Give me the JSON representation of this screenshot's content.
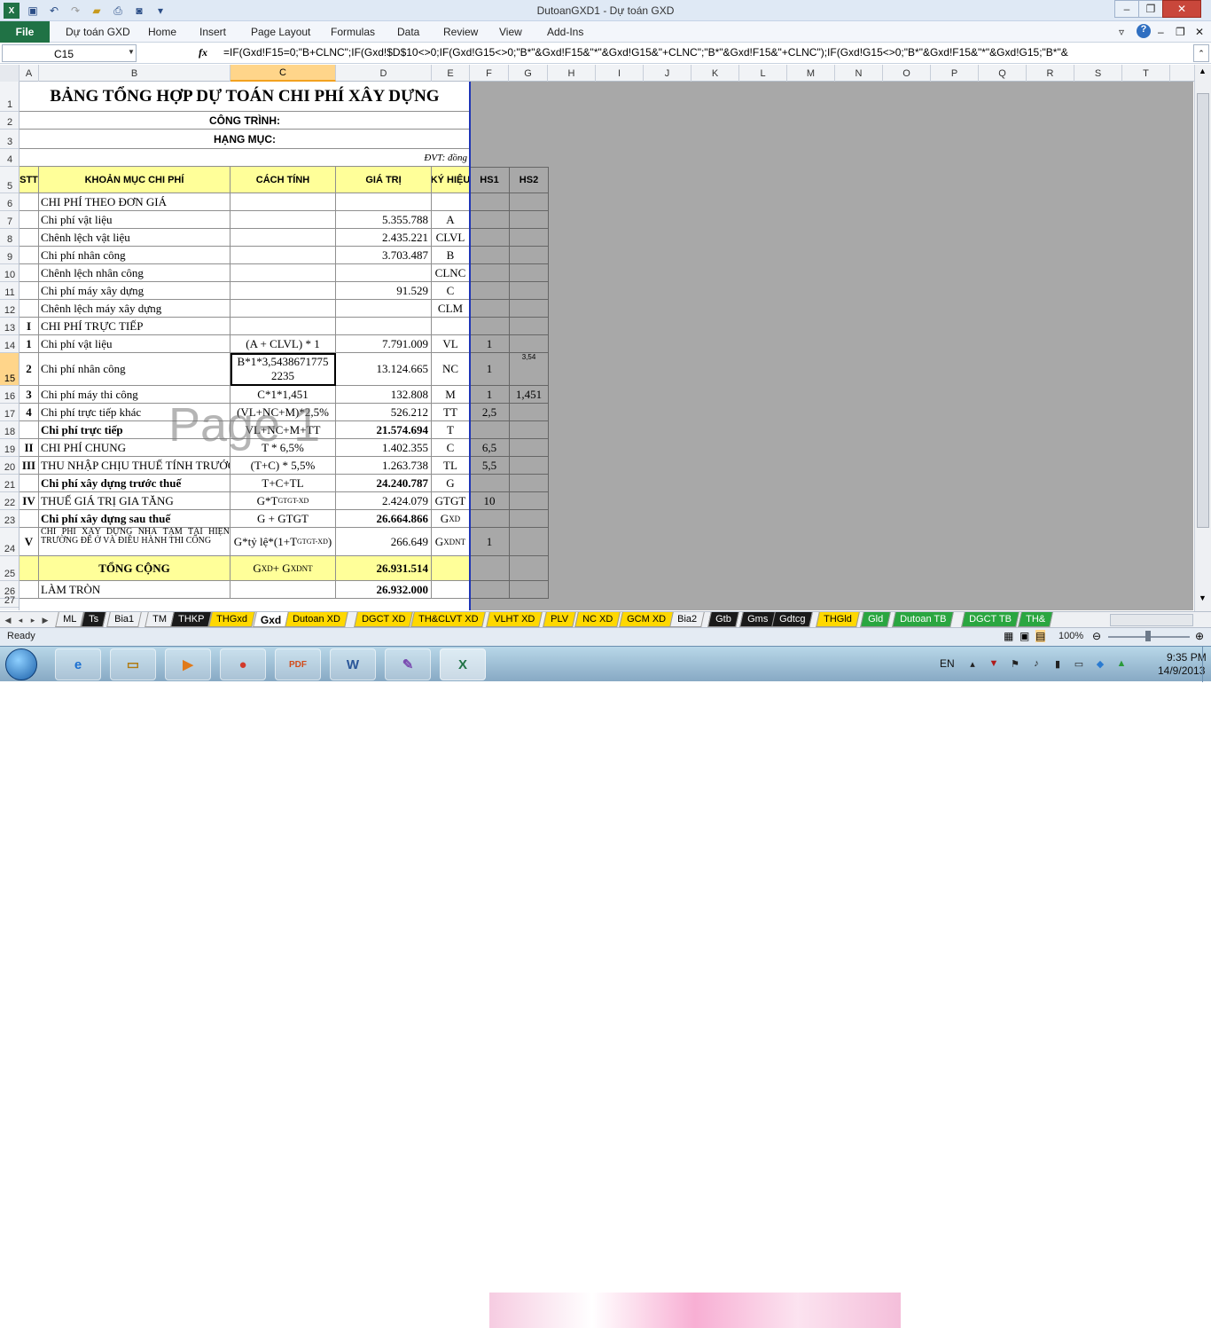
{
  "window": {
    "title": "DutoanGXD1 - Dự toán GXD"
  },
  "ribbon": {
    "file": "File",
    "tabs": [
      "Dự toán GXD",
      "Home",
      "Insert",
      "Page Layout",
      "Formulas",
      "Data",
      "Review",
      "View",
      "Add-Ins"
    ]
  },
  "formula_bar": {
    "name_box": "C15",
    "fx": "fx",
    "formula": "=IF(Gxd!F15=0;\"B+CLNC\";IF(Gxd!$D$10<>0;IF(Gxd!G15<>0;\"B*\"&Gxd!F15&\"*\"&Gxd!G15&\"+CLNC\";\"B*\"&Gxd!F15&\"+CLNC\");IF(Gxd!G15<>0;\"B*\"&Gxd!F15&\"*\"&Gxd!G15;\"B*\"&"
  },
  "columns": [
    "A",
    "B",
    "C",
    "D",
    "E",
    "F",
    "G",
    "H",
    "I",
    "J",
    "K",
    "L",
    "M",
    "N",
    "O",
    "P",
    "Q",
    "R",
    "S",
    "T"
  ],
  "rows_numbers": [
    "1",
    "2",
    "3",
    "4",
    "5",
    "6",
    "7",
    "8",
    "9",
    "10",
    "11",
    "12",
    "13",
    "14",
    "15",
    "16",
    "17",
    "18",
    "19",
    "20",
    "21",
    "22",
    "23",
    "24",
    "25",
    "26",
    "27"
  ],
  "sheet": {
    "title": "BẢNG TỔNG HỢP DỰ TOÁN CHI PHÍ XÂY DỰNG",
    "project": "CÔNG TRÌNH:",
    "item": "HẠNG MỤC:",
    "unit": "ĐVT: đồng",
    "headers": {
      "stt": "STT",
      "khoan_muc": "KHOẢN MỤC CHI PHÍ",
      "cach_tinh": "CÁCH TÍNH",
      "gia_tri": "GIÁ TRỊ",
      "ky_hieu": "KÝ HIỆU",
      "hs1": "HS1",
      "hs2": "HS2"
    },
    "rows": [
      {
        "stt": "",
        "name": "CHI PHÍ THEO ĐƠN GIÁ",
        "calc": "",
        "value": "",
        "sym": "",
        "hs1": "",
        "hs2": ""
      },
      {
        "stt": "",
        "name": "Chi phí vật liệu",
        "calc": "",
        "value": "5.355.788",
        "sym": "A",
        "hs1": "",
        "hs2": ""
      },
      {
        "stt": "",
        "name": "Chênh lệch vật liệu",
        "calc": "",
        "value": "2.435.221",
        "sym": "CLVL",
        "hs1": "",
        "hs2": ""
      },
      {
        "stt": "",
        "name": "Chi phí nhân công",
        "calc": "",
        "value": "3.703.487",
        "sym": "B",
        "hs1": "",
        "hs2": ""
      },
      {
        "stt": "",
        "name": "Chênh lệch nhân công",
        "calc": "",
        "value": "",
        "sym": "CLNC",
        "hs1": "",
        "hs2": ""
      },
      {
        "stt": "",
        "name": "Chi phí máy xây dựng",
        "calc": "",
        "value": "91.529",
        "sym": "C",
        "hs1": "",
        "hs2": ""
      },
      {
        "stt": "",
        "name": "Chênh lệch máy xây dựng",
        "calc": "",
        "value": "",
        "sym": "CLM",
        "hs1": "",
        "hs2": ""
      },
      {
        "stt": "I",
        "name": "CHI PHÍ TRỰC TIẾP",
        "calc": "",
        "value": "",
        "sym": "",
        "hs1": "",
        "hs2": ""
      },
      {
        "stt": "1",
        "name": "Chi phí vật liệu",
        "calc": "(A + CLVL) * 1",
        "value": "7.791.009",
        "sym": "VL",
        "hs1": "1",
        "hs2": ""
      },
      {
        "stt": "2",
        "name": "Chi phí nhân công",
        "calc": "B*1*3,5438671775 2235",
        "value": "13.124.665",
        "sym": "NC",
        "hs1": "1",
        "hs2": "3,54"
      },
      {
        "stt": "3",
        "name": "Chi phí máy thi công",
        "calc": "C*1*1,451",
        "value": "132.808",
        "sym": "M",
        "hs1": "1",
        "hs2": "1,451"
      },
      {
        "stt": "4",
        "name": "Chi phí trực tiếp khác",
        "calc": "(VL+NC+M)*2,5%",
        "value": "526.212",
        "sym": "TT",
        "hs1": "2,5",
        "hs2": ""
      },
      {
        "stt": "",
        "name": "Chi phí trực tiếp",
        "calc": "VL+NC+M+TT",
        "value": "21.574.694",
        "sym": "T",
        "hs1": "",
        "hs2": ""
      },
      {
        "stt": "II",
        "name": "CHI PHÍ CHUNG",
        "calc": "T * 6,5%",
        "value": "1.402.355",
        "sym": "C",
        "hs1": "6,5",
        "hs2": ""
      },
      {
        "stt": "III",
        "name": "THU NHẬP CHỊU THUẾ TÍNH TRƯỚC",
        "calc": "(T+C) * 5,5%",
        "value": "1.263.738",
        "sym": "TL",
        "hs1": "5,5",
        "hs2": ""
      },
      {
        "stt": "",
        "name": "Chi phí xây dựng trước thuế",
        "calc": "T+C+TL",
        "value": "24.240.787",
        "sym": "G",
        "hs1": "",
        "hs2": ""
      },
      {
        "stt": "IV",
        "name": "THUẾ GIÁ TRỊ GIA TĂNG",
        "calc": "G*T",
        "calc_sup": "GTGT-XD",
        "value": "2.424.079",
        "sym": "GTGT",
        "hs1": "10",
        "hs2": ""
      },
      {
        "stt": "",
        "name": "Chi phí xây dựng sau thuế",
        "calc": "G + GTGT",
        "value": "26.664.866",
        "sym": "G",
        "sym_sub": "XD",
        "hs1": "",
        "hs2": ""
      },
      {
        "stt": "V",
        "name": "CHI PHÍ XÂY DỰNG NHÀ TẠM TẠI HIỆN TRƯỜNG ĐỂ Ở VÀ ĐIỀU HÀNH THI CÔNG",
        "calc": "G*tỷ lệ*(1+T",
        "calc_sup": "GTGT-XD",
        "calc_end": ")",
        "value": "266.649",
        "sym": "G",
        "sym_sub": "XDNT",
        "hs1": "1",
        "hs2": ""
      },
      {
        "stt": "",
        "name": "TỔNG CỘNG",
        "calc": "G",
        "calc_sub1": "XD",
        "calc_mid": " + G",
        "calc_sub2": "XDNT",
        "value": "26.931.514",
        "sym": "",
        "hs1": "",
        "hs2": ""
      },
      {
        "stt": "",
        "name": "LÀM TRÒN",
        "calc": "",
        "value": "26.932.000",
        "sym": "",
        "hs1": "",
        "hs2": ""
      }
    ],
    "watermark": "Page 1"
  },
  "sheet_tabs": [
    "ML",
    "Ts",
    "Bia1",
    "TM",
    "THKP",
    "THGxd",
    "Gxd",
    "Dutoan XD",
    "DGCT XD",
    "TH&CLVT XD",
    "VLHT XD",
    "PLV",
    "NC XD",
    "GCM XD",
    "Bia2",
    "Gtb",
    "Gms",
    "Gdtcg",
    "THGld",
    "Gld",
    "Dutoan TB",
    "DGCT TB",
    "TH&"
  ],
  "active_tab": "Gxd",
  "status": {
    "ready": "Ready",
    "zoom": "100%"
  },
  "taskbar": {
    "lang": "EN",
    "time": "9:35 PM",
    "date": "14/9/2013"
  }
}
